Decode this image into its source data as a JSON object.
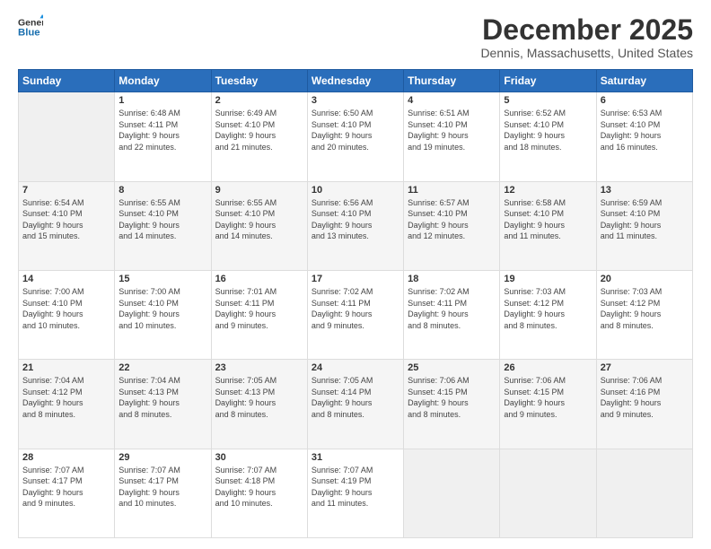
{
  "header": {
    "logo_line1": "General",
    "logo_line2": "Blue",
    "month": "December 2025",
    "location": "Dennis, Massachusetts, United States"
  },
  "weekdays": [
    "Sunday",
    "Monday",
    "Tuesday",
    "Wednesday",
    "Thursday",
    "Friday",
    "Saturday"
  ],
  "weeks": [
    [
      {
        "day": "",
        "info": ""
      },
      {
        "day": "1",
        "info": "Sunrise: 6:48 AM\nSunset: 4:11 PM\nDaylight: 9 hours\nand 22 minutes."
      },
      {
        "day": "2",
        "info": "Sunrise: 6:49 AM\nSunset: 4:10 PM\nDaylight: 9 hours\nand 21 minutes."
      },
      {
        "day": "3",
        "info": "Sunrise: 6:50 AM\nSunset: 4:10 PM\nDaylight: 9 hours\nand 20 minutes."
      },
      {
        "day": "4",
        "info": "Sunrise: 6:51 AM\nSunset: 4:10 PM\nDaylight: 9 hours\nand 19 minutes."
      },
      {
        "day": "5",
        "info": "Sunrise: 6:52 AM\nSunset: 4:10 PM\nDaylight: 9 hours\nand 18 minutes."
      },
      {
        "day": "6",
        "info": "Sunrise: 6:53 AM\nSunset: 4:10 PM\nDaylight: 9 hours\nand 16 minutes."
      }
    ],
    [
      {
        "day": "7",
        "info": "Sunrise: 6:54 AM\nSunset: 4:10 PM\nDaylight: 9 hours\nand 15 minutes."
      },
      {
        "day": "8",
        "info": "Sunrise: 6:55 AM\nSunset: 4:10 PM\nDaylight: 9 hours\nand 14 minutes."
      },
      {
        "day": "9",
        "info": "Sunrise: 6:55 AM\nSunset: 4:10 PM\nDaylight: 9 hours\nand 14 minutes."
      },
      {
        "day": "10",
        "info": "Sunrise: 6:56 AM\nSunset: 4:10 PM\nDaylight: 9 hours\nand 13 minutes."
      },
      {
        "day": "11",
        "info": "Sunrise: 6:57 AM\nSunset: 4:10 PM\nDaylight: 9 hours\nand 12 minutes."
      },
      {
        "day": "12",
        "info": "Sunrise: 6:58 AM\nSunset: 4:10 PM\nDaylight: 9 hours\nand 11 minutes."
      },
      {
        "day": "13",
        "info": "Sunrise: 6:59 AM\nSunset: 4:10 PM\nDaylight: 9 hours\nand 11 minutes."
      }
    ],
    [
      {
        "day": "14",
        "info": "Sunrise: 7:00 AM\nSunset: 4:10 PM\nDaylight: 9 hours\nand 10 minutes."
      },
      {
        "day": "15",
        "info": "Sunrise: 7:00 AM\nSunset: 4:10 PM\nDaylight: 9 hours\nand 10 minutes."
      },
      {
        "day": "16",
        "info": "Sunrise: 7:01 AM\nSunset: 4:11 PM\nDaylight: 9 hours\nand 9 minutes."
      },
      {
        "day": "17",
        "info": "Sunrise: 7:02 AM\nSunset: 4:11 PM\nDaylight: 9 hours\nand 9 minutes."
      },
      {
        "day": "18",
        "info": "Sunrise: 7:02 AM\nSunset: 4:11 PM\nDaylight: 9 hours\nand 8 minutes."
      },
      {
        "day": "19",
        "info": "Sunrise: 7:03 AM\nSunset: 4:12 PM\nDaylight: 9 hours\nand 8 minutes."
      },
      {
        "day": "20",
        "info": "Sunrise: 7:03 AM\nSunset: 4:12 PM\nDaylight: 9 hours\nand 8 minutes."
      }
    ],
    [
      {
        "day": "21",
        "info": "Sunrise: 7:04 AM\nSunset: 4:12 PM\nDaylight: 9 hours\nand 8 minutes."
      },
      {
        "day": "22",
        "info": "Sunrise: 7:04 AM\nSunset: 4:13 PM\nDaylight: 9 hours\nand 8 minutes."
      },
      {
        "day": "23",
        "info": "Sunrise: 7:05 AM\nSunset: 4:13 PM\nDaylight: 9 hours\nand 8 minutes."
      },
      {
        "day": "24",
        "info": "Sunrise: 7:05 AM\nSunset: 4:14 PM\nDaylight: 9 hours\nand 8 minutes."
      },
      {
        "day": "25",
        "info": "Sunrise: 7:06 AM\nSunset: 4:15 PM\nDaylight: 9 hours\nand 8 minutes."
      },
      {
        "day": "26",
        "info": "Sunrise: 7:06 AM\nSunset: 4:15 PM\nDaylight: 9 hours\nand 9 minutes."
      },
      {
        "day": "27",
        "info": "Sunrise: 7:06 AM\nSunset: 4:16 PM\nDaylight: 9 hours\nand 9 minutes."
      }
    ],
    [
      {
        "day": "28",
        "info": "Sunrise: 7:07 AM\nSunset: 4:17 PM\nDaylight: 9 hours\nand 9 minutes."
      },
      {
        "day": "29",
        "info": "Sunrise: 7:07 AM\nSunset: 4:17 PM\nDaylight: 9 hours\nand 10 minutes."
      },
      {
        "day": "30",
        "info": "Sunrise: 7:07 AM\nSunset: 4:18 PM\nDaylight: 9 hours\nand 10 minutes."
      },
      {
        "day": "31",
        "info": "Sunrise: 7:07 AM\nSunset: 4:19 PM\nDaylight: 9 hours\nand 11 minutes."
      },
      {
        "day": "",
        "info": ""
      },
      {
        "day": "",
        "info": ""
      },
      {
        "day": "",
        "info": ""
      }
    ]
  ]
}
